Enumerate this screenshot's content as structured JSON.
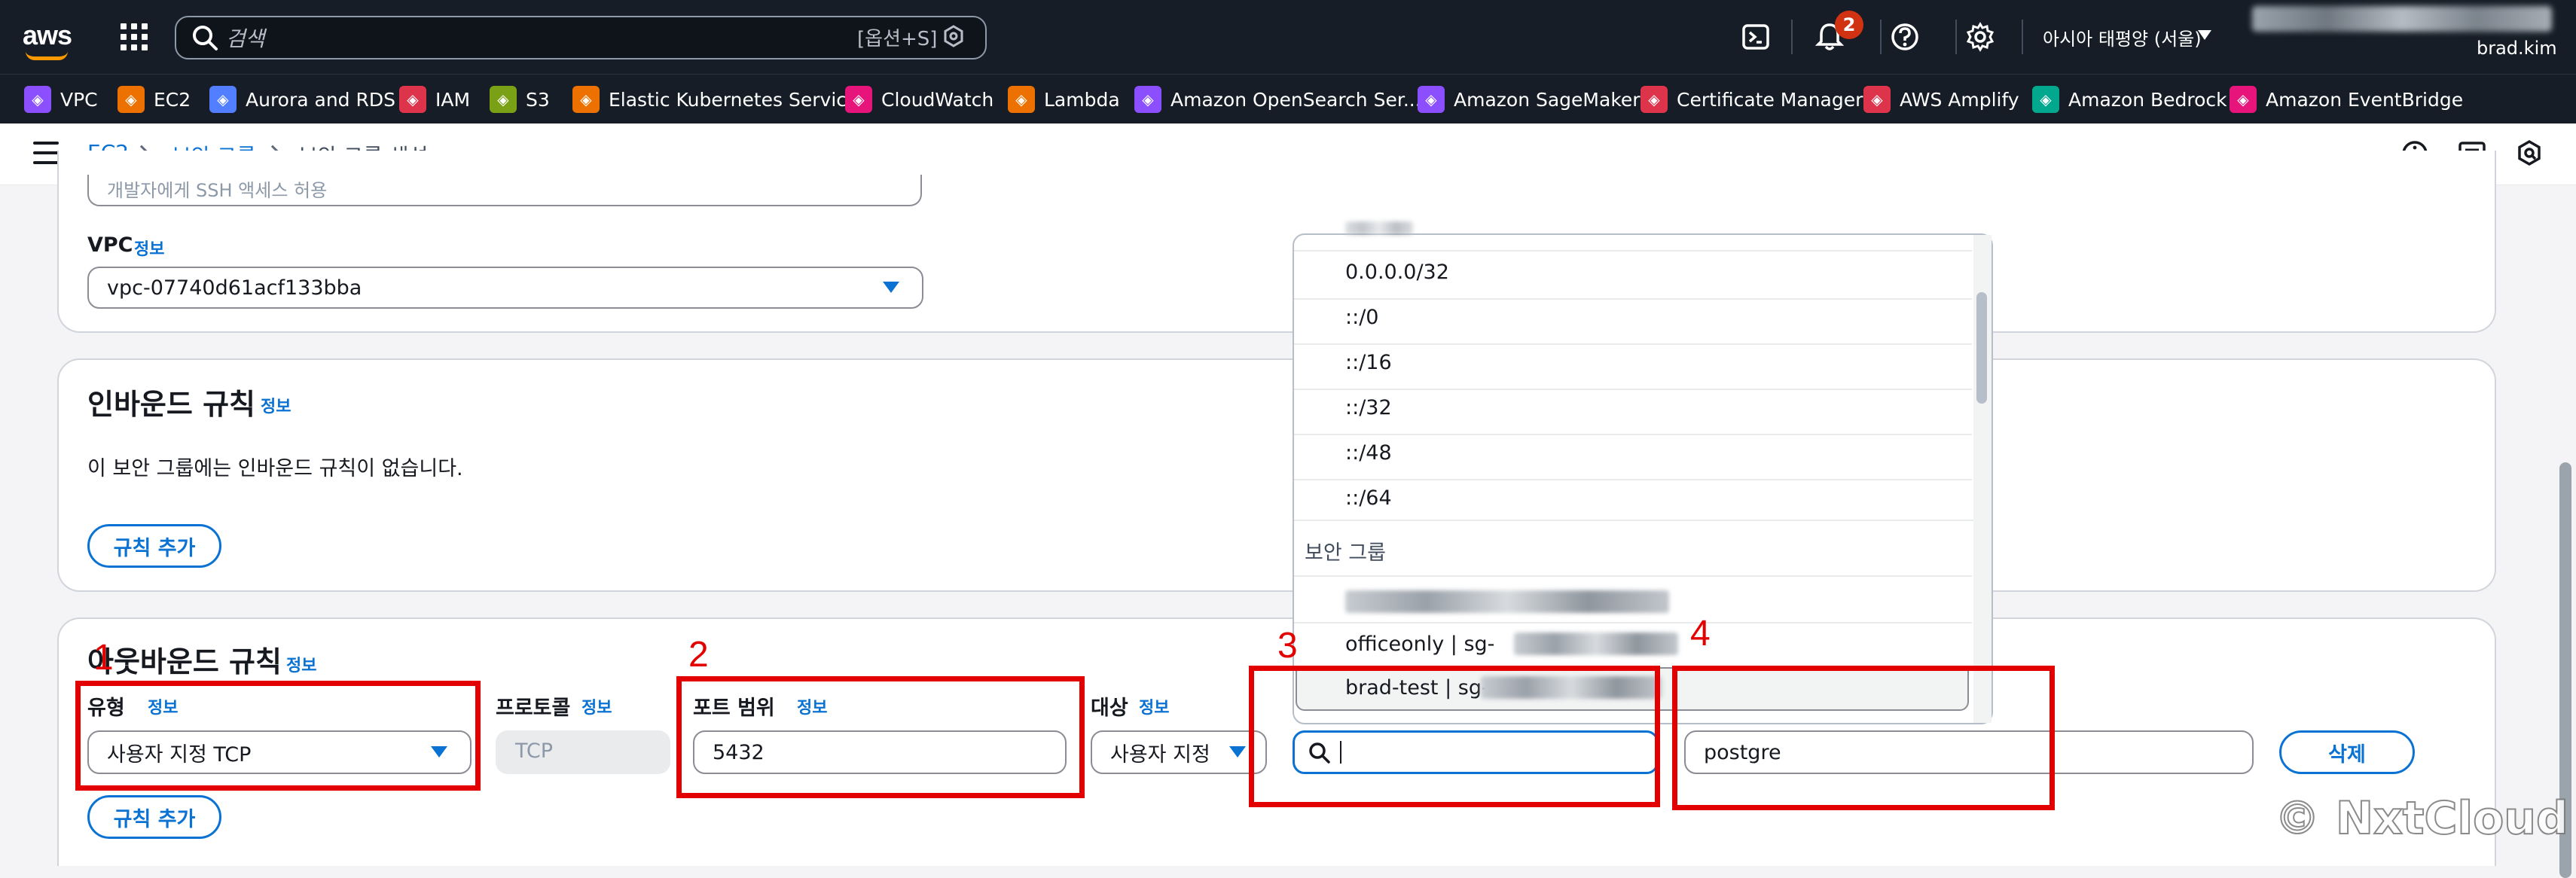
{
  "top_nav": {
    "logo_text": "aws",
    "search_placeholder": "검색",
    "search_shortcut": "[옵션+S]",
    "notification_count": "2",
    "region": "아시아 태평양 (서울)",
    "username": "brad.kim"
  },
  "favorites": [
    {
      "label": "VPC",
      "icon": "vpc-icon",
      "color": "#8c4fff"
    },
    {
      "label": "EC2",
      "icon": "ec2-icon",
      "color": "#ed7100"
    },
    {
      "label": "Aurora and RDS",
      "icon": "rds-icon",
      "color": "#527fff"
    },
    {
      "label": "IAM",
      "icon": "iam-icon",
      "color": "#dd344c"
    },
    {
      "label": "S3",
      "icon": "s3-icon",
      "color": "#7aa116"
    },
    {
      "label": "Elastic Kubernetes Service",
      "icon": "eks-icon",
      "color": "#ed7100"
    },
    {
      "label": "CloudWatch",
      "icon": "cloudwatch-icon",
      "color": "#e7157b"
    },
    {
      "label": "Lambda",
      "icon": "lambda-icon",
      "color": "#ed7100"
    },
    {
      "label": "Amazon OpenSearch Ser...",
      "icon": "opensearch-icon",
      "color": "#8c4fff"
    },
    {
      "label": "Amazon SageMaker",
      "icon": "sagemaker-icon",
      "color": "#8c4fff"
    },
    {
      "label": "Certificate Manager",
      "icon": "acm-icon",
      "color": "#dd344c"
    },
    {
      "label": "AWS Amplify",
      "icon": "amplify-icon",
      "color": "#dd344c"
    },
    {
      "label": "Amazon Bedrock",
      "icon": "bedrock-icon",
      "color": "#01a88d"
    },
    {
      "label": "Amazon EventBridge",
      "icon": "eventbridge-icon",
      "color": "#e7157b"
    }
  ],
  "breadcrumb": {
    "root": "EC2",
    "parent": "보안 그룹",
    "current": "보안 그룹 생성"
  },
  "basic": {
    "desc_value": "개발자에게 SSH 액세스 허용",
    "vpc_label": "VPC",
    "info": "정보",
    "vpc_value": "vpc-07740d61acf133bba"
  },
  "inbound": {
    "title": "인바운드 규칙",
    "info": "정보",
    "empty_text": "이 보안 그룹에는 인바운드 규칙이 없습니다.",
    "add_rule": "규칙 추가"
  },
  "outbound": {
    "title": "아웃바운드 규칙",
    "info": "정보",
    "type_label": "유형",
    "type_value": "사용자 지정 TCP",
    "protocol_label": "프로토콜",
    "protocol_value": "TCP",
    "port_label": "포트 범위",
    "port_value": "5432",
    "dest_label": "대상",
    "dest_select": "사용자 지정",
    "dest_search_value": "",
    "description_value": "postgre",
    "delete": "삭제",
    "add_rule": "규칙 추가"
  },
  "dropdown": {
    "options": [
      "0.0.0.0/32",
      "::/0",
      "::/16",
      "::/32",
      "::/48",
      "::/64"
    ],
    "group_header": "보안 그룹",
    "sg_items": [
      "officeonly | sg-",
      "brad-test | sg-"
    ]
  },
  "annotations": [
    "1",
    "2",
    "3",
    "4"
  ],
  "watermark": "© NxtCloud",
  "colors": {
    "nav_bg": "#161d26",
    "link_blue": "#0972d3",
    "annotation_red": "#e30000"
  }
}
